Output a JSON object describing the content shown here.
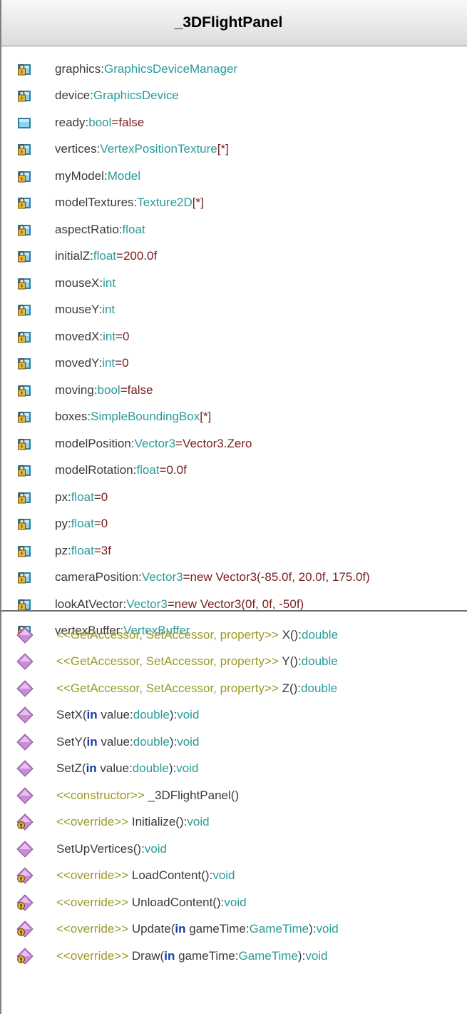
{
  "header": {
    "title": "_3DFlightPanel"
  },
  "attributes": [
    {
      "icon": "private-attribute-icon",
      "name": "graphics",
      "type": "GraphicsDeviceManager"
    },
    {
      "icon": "private-attribute-icon",
      "name": "device",
      "type": "GraphicsDevice"
    },
    {
      "icon": "public-attribute-icon",
      "name": "ready",
      "type": "bool",
      "default": "false"
    },
    {
      "icon": "private-attribute-icon",
      "name": "vertices",
      "type": "VertexPositionTexture",
      "multiplicity": "[*]"
    },
    {
      "icon": "private-attribute-icon",
      "name": "myModel",
      "type": "Model"
    },
    {
      "icon": "private-attribute-icon",
      "name": "modelTextures",
      "type": "Texture2D",
      "multiplicity": "[*]"
    },
    {
      "icon": "private-attribute-icon",
      "name": "aspectRatio",
      "type": "float"
    },
    {
      "icon": "private-attribute-icon",
      "name": "initialZ",
      "type": "float",
      "default": "200.0f"
    },
    {
      "icon": "private-attribute-icon",
      "name": "mouseX",
      "type": "int"
    },
    {
      "icon": "private-attribute-icon",
      "name": "mouseY",
      "type": "int"
    },
    {
      "icon": "private-attribute-icon",
      "name": "movedX",
      "type": "int",
      "default": "0"
    },
    {
      "icon": "private-attribute-icon",
      "name": "movedY",
      "type": "int",
      "default": "0"
    },
    {
      "icon": "private-attribute-icon",
      "name": "moving",
      "type": "bool",
      "default": "false"
    },
    {
      "icon": "private-attribute-icon",
      "name": "boxes",
      "type": "SimpleBoundingBox",
      "multiplicity": "[*]"
    },
    {
      "icon": "private-attribute-icon",
      "name": "modelPosition",
      "type": "Vector3",
      "default": "Vector3.Zero"
    },
    {
      "icon": "private-attribute-icon",
      "name": "modelRotation",
      "type": "float",
      "default": "0.0f"
    },
    {
      "icon": "private-attribute-icon",
      "name": "px",
      "type": "float",
      "default": "0"
    },
    {
      "icon": "private-attribute-icon",
      "name": "py",
      "type": "float",
      "default": "0"
    },
    {
      "icon": "private-attribute-icon",
      "name": "pz",
      "type": "float",
      "default": "3f"
    },
    {
      "icon": "private-attribute-icon",
      "name": "cameraPosition",
      "type": "Vector3",
      "default": "new Vector3(-85.0f, 20.0f, 175.0f)"
    },
    {
      "icon": "private-attribute-icon",
      "name": "lookAtVector",
      "type": "Vector3",
      "default": "new Vector3(0f, 0f, -50f)"
    },
    {
      "icon": "private-attribute-icon",
      "name": "vertexBuffer",
      "type": "VertexBuffer"
    }
  ],
  "operations": [
    {
      "icon": "public-operation-icon",
      "stereotype": "<<GetAccessor, SetAccessor, property>>",
      "name": "X",
      "params": [],
      "return": "double"
    },
    {
      "icon": "public-operation-icon",
      "stereotype": "<<GetAccessor, SetAccessor, property>>",
      "name": "Y",
      "params": [],
      "return": "double"
    },
    {
      "icon": "public-operation-icon",
      "stereotype": "<<GetAccessor, SetAccessor, property>>",
      "name": "Z",
      "params": [],
      "return": "double"
    },
    {
      "icon": "public-operation-icon",
      "name": "SetX",
      "params": [
        {
          "kind": "in",
          "name": "value",
          "type": "double"
        }
      ],
      "return": "void"
    },
    {
      "icon": "public-operation-icon",
      "name": "SetY",
      "params": [
        {
          "kind": "in",
          "name": "value",
          "type": "double"
        }
      ],
      "return": "void"
    },
    {
      "icon": "public-operation-icon",
      "name": "SetZ",
      "params": [
        {
          "kind": "in",
          "name": "value",
          "type": "double"
        }
      ],
      "return": "void"
    },
    {
      "icon": "public-operation-icon",
      "stereotype": "<<constructor>>",
      "name": "_3DFlightPanel",
      "params": []
    },
    {
      "icon": "protected-operation-icon",
      "stereotype": "<<override>>",
      "name": "Initialize",
      "params": [],
      "return": "void"
    },
    {
      "icon": "public-operation-icon",
      "name": "SetUpVertices",
      "params": [],
      "return": "void"
    },
    {
      "icon": "protected-operation-icon",
      "stereotype": "<<override>>",
      "name": "LoadContent",
      "params": [],
      "return": "void"
    },
    {
      "icon": "protected-operation-icon",
      "stereotype": "<<override>>",
      "name": "UnloadContent",
      "params": [],
      "return": "void"
    },
    {
      "icon": "protected-operation-icon",
      "stereotype": "<<override>>",
      "name": "Update",
      "params": [
        {
          "kind": "in",
          "name": "gameTime",
          "type": "GameTime"
        }
      ],
      "return": "void"
    },
    {
      "icon": "protected-operation-icon",
      "stereotype": "<<override>>",
      "name": "Draw",
      "params": [
        {
          "kind": "in",
          "name": "gameTime",
          "type": "GameTime"
        }
      ],
      "return": "void"
    }
  ]
}
